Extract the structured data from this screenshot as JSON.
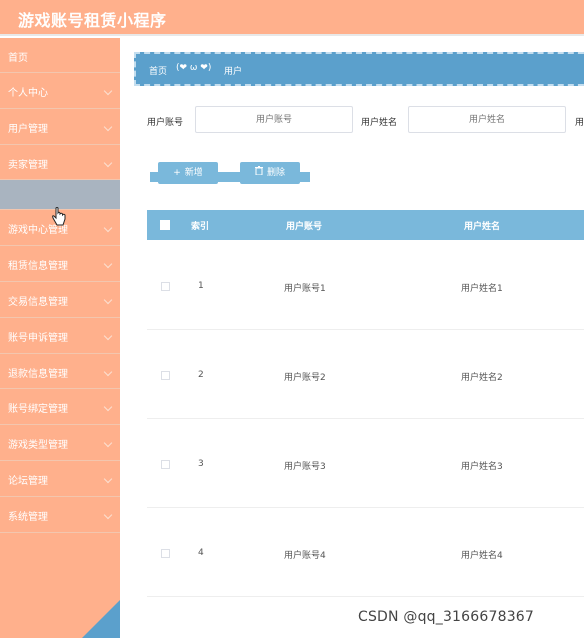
{
  "header": {
    "title": "游戏账号租赁小程序"
  },
  "sidebar": {
    "items": [
      {
        "label": "首页",
        "has_chevron": false
      },
      {
        "label": "个人中心",
        "has_chevron": true
      },
      {
        "label": "用户管理",
        "has_chevron": true
      },
      {
        "label": "卖家管理",
        "has_chevron": true
      },
      {
        "label": "游戏中心管理",
        "has_chevron": true
      },
      {
        "label": "租赁信息管理",
        "has_chevron": true
      },
      {
        "label": "交易信息管理",
        "has_chevron": true
      },
      {
        "label": "账号申诉管理",
        "has_chevron": true
      },
      {
        "label": "退款信息管理",
        "has_chevron": true
      },
      {
        "label": "账号绑定管理",
        "has_chevron": true
      },
      {
        "label": "游戏类型管理",
        "has_chevron": true
      },
      {
        "label": "论坛管理",
        "has_chevron": true
      },
      {
        "label": "系统管理",
        "has_chevron": true
      }
    ]
  },
  "breadcrumb": {
    "home": "首页",
    "separator": "(❤ ω ❤)",
    "current": "用户"
  },
  "search": {
    "account_label": "用户账号",
    "account_placeholder": "用户账号",
    "name_label": "用户姓名",
    "name_placeholder": "用户姓名",
    "third_label": "用"
  },
  "toolbar": {
    "add_label": "新增",
    "delete_label": "删除"
  },
  "table": {
    "headers": [
      "索引",
      "用户账号",
      "用户姓名"
    ],
    "rows": [
      {
        "index": "1",
        "account": "用户账号1",
        "name": "用户姓名1"
      },
      {
        "index": "2",
        "account": "用户账号2",
        "name": "用户姓名2"
      },
      {
        "index": "3",
        "account": "用户账号3",
        "name": "用户姓名3"
      },
      {
        "index": "4",
        "account": "用户账号4",
        "name": "用户姓名4"
      }
    ]
  },
  "watermark": "CSDN @qq_3166678367",
  "colors": {
    "sidebar": "#ffb08c",
    "accent": "#5ba0cc",
    "table_header": "#7ab8db"
  },
  "icons": {
    "add": "plus-icon",
    "delete": "trash-icon",
    "cursor": "hand-cursor-icon"
  }
}
